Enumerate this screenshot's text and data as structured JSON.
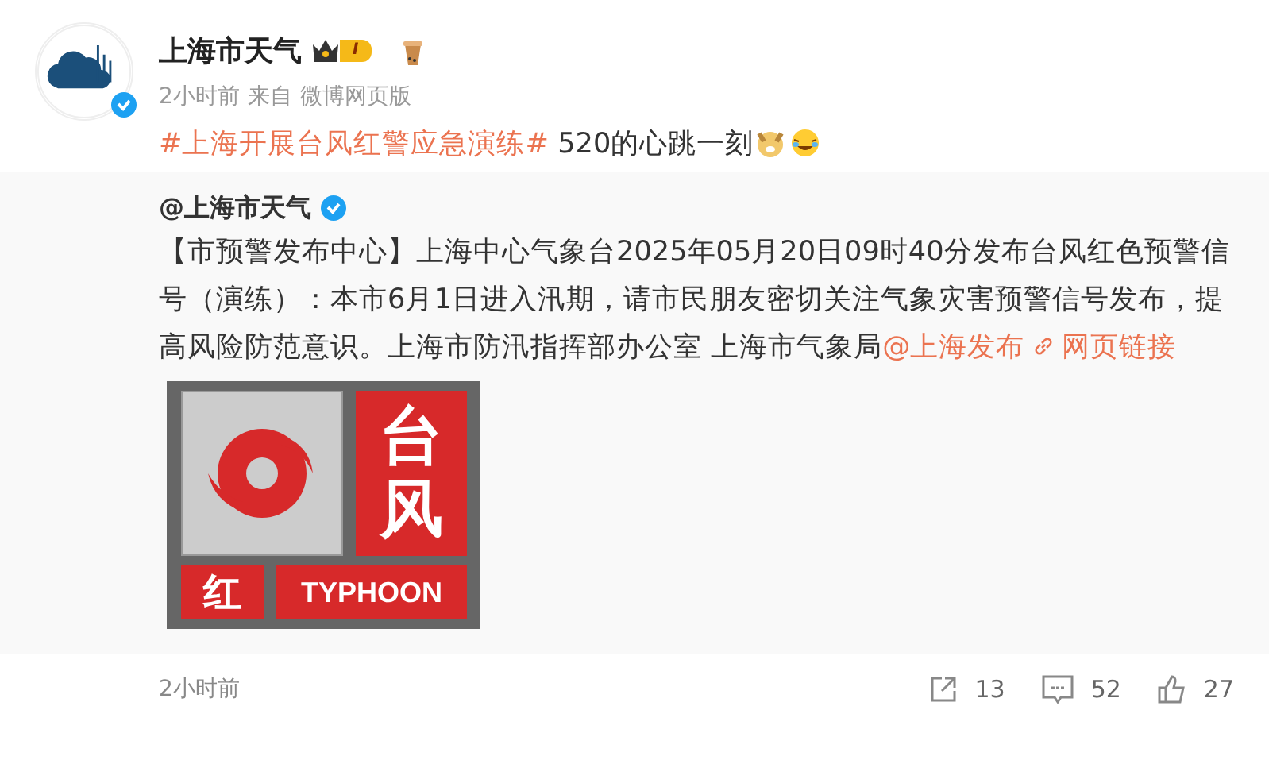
{
  "author": {
    "name": "上海市天气",
    "level_badge": "I",
    "verified": true
  },
  "meta": {
    "time": "2小时前",
    "source_prefix": "来自",
    "source": "微博网页版"
  },
  "post": {
    "topic": "#上海开展台风红警应急演练#",
    "text": " 520的心跳一刻"
  },
  "repost": {
    "author": "@上海市天气",
    "verified": true,
    "text_before": "【市预警发布中心】上海中心气象台2025年05月20日09时40分发布台风红色预警信号（演练）：本市6月1日进入汛期，请市民朋友密切关注气象灾害预警信号发布，提高风险防范意识。上海市防汛指挥部办公室 上海市气象局",
    "mention": "@上海发布",
    "link": "网页链接",
    "sign": {
      "title": "台风",
      "level": "红",
      "english": "TYPHOON"
    },
    "time": "2小时前",
    "actions": [
      {
        "kind": "share",
        "count": "13"
      },
      {
        "kind": "comment",
        "count": "52"
      },
      {
        "kind": "like",
        "count": "27"
      }
    ]
  }
}
